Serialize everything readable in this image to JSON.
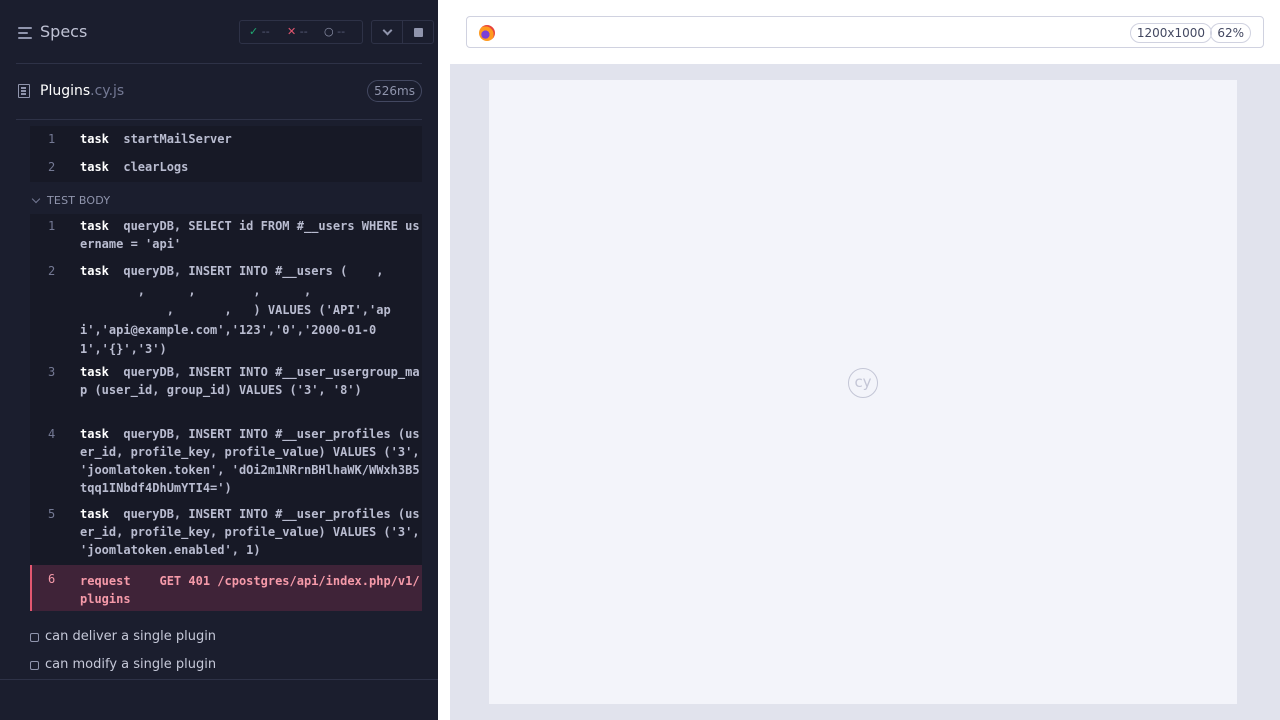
{
  "reporter": {
    "title": "Specs",
    "stats": {
      "passed": "--",
      "failed": "--",
      "pending": "--"
    },
    "spec": {
      "name": "Plugins",
      "ext": ".cy.js",
      "duration": "526ms"
    },
    "before_commands": [
      {
        "num": "1",
        "name": "task",
        "message": "startMailServer"
      },
      {
        "num": "2",
        "name": "task",
        "message": "clearLogs"
      }
    ],
    "test_body_label": "TEST BODY",
    "commands": [
      {
        "num": "1",
        "name": "task",
        "message": "queryDB, SELECT id FROM #__users WHERE username = 'api'"
      },
      {
        "num": "2",
        "name": "task",
        "message": "queryDB, INSERT INTO #__users (    ,\n        ,      ,        ,      ,\n            ,       ,   ) VALUES ('API','api','api@example.com','123','0','2000-01-01','{}','3')"
      },
      {
        "num": "3",
        "name": "task",
        "message": "queryDB, INSERT INTO #__user_usergroup_map (user_id, group_id) VALUES ('3', '8')"
      },
      {
        "num": "4",
        "name": "task",
        "message": "queryDB, INSERT INTO #__user_profiles (user_id, profile_key, profile_value) VALUES ('3', 'joomlatoken.token', 'dOi2m1NRrnBHlhaWK/WWxh3B5tqq1INbdf4DhUmYTI4=')"
      },
      {
        "num": "5",
        "name": "task",
        "message": "queryDB, INSERT INTO #__user_profiles (user_id, profile_key, profile_value) VALUES ('3', 'joomlatoken.enabled', 1)"
      },
      {
        "num": "6",
        "name": "request",
        "message": "GET 401 /cpostgres/api/index.php/v1/plugins"
      }
    ],
    "tests": [
      {
        "label": "can deliver a single plugin"
      },
      {
        "label": "can modify a single plugin"
      }
    ]
  },
  "aut": {
    "viewport": "1200x1000",
    "zoom": "62%",
    "logo_text": "cy"
  },
  "colors": {
    "pass": "#1fa971",
    "fail": "#e45770",
    "error_bg": "#3f2338"
  }
}
